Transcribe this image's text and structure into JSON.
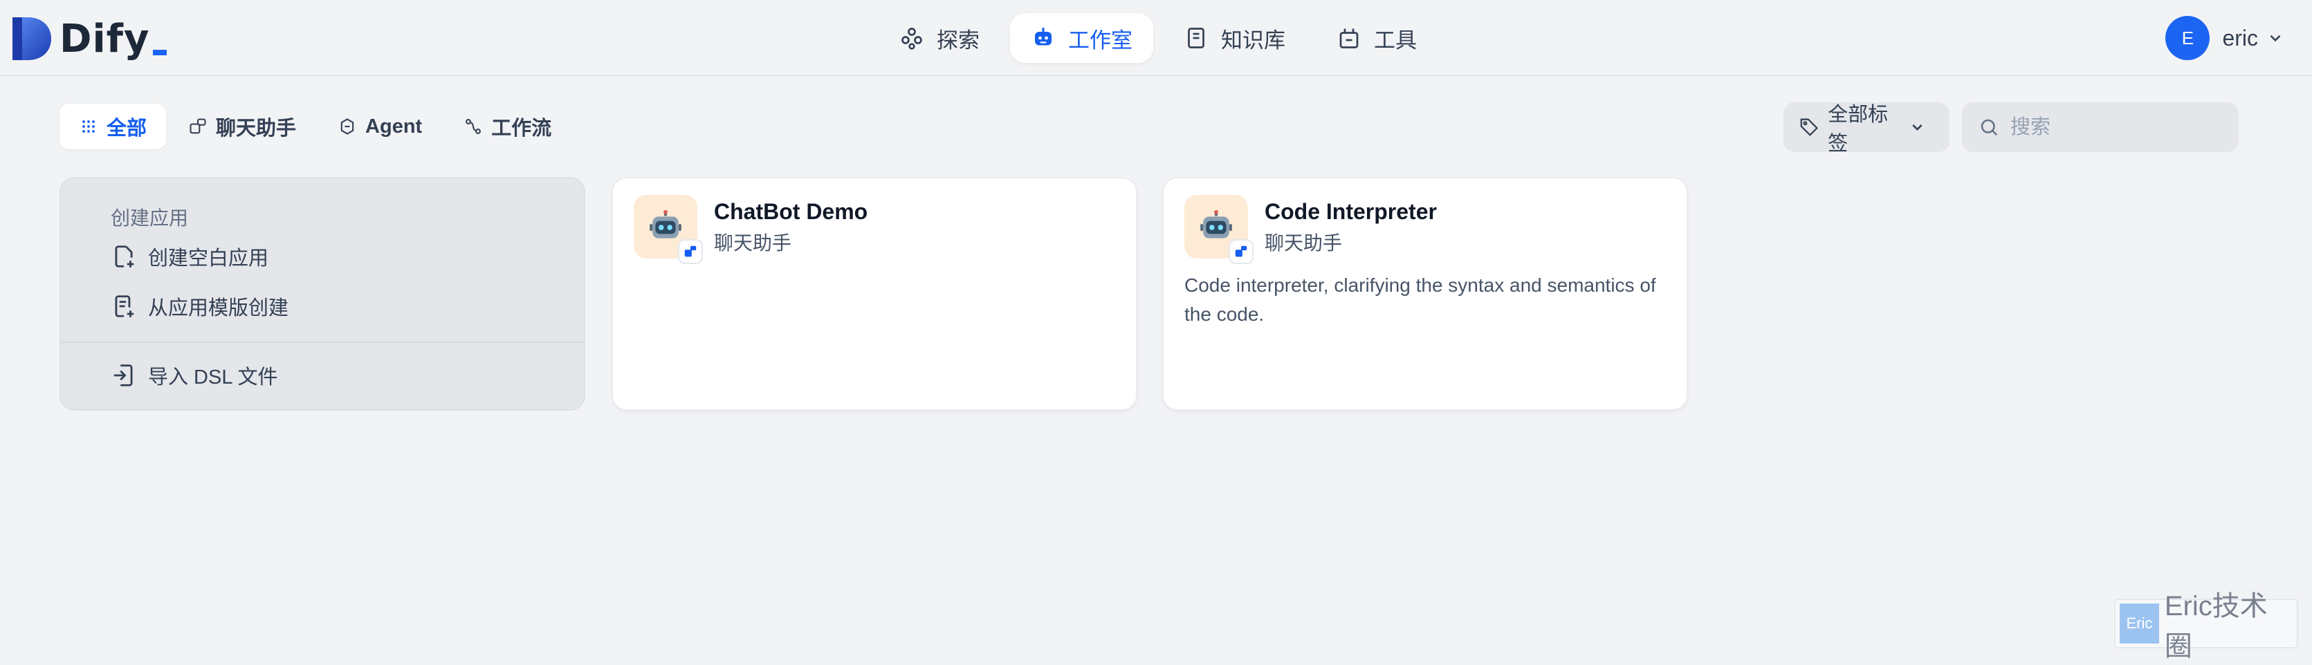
{
  "brand": {
    "name": "Dify"
  },
  "nav": {
    "items": [
      {
        "label": "探索",
        "icon": "explore-icon",
        "active": false
      },
      {
        "label": "工作室",
        "icon": "robot-icon",
        "active": true
      },
      {
        "label": "知识库",
        "icon": "book-icon",
        "active": false
      },
      {
        "label": "工具",
        "icon": "tools-icon",
        "active": false
      }
    ]
  },
  "user": {
    "initial": "E",
    "name": "eric"
  },
  "filters": {
    "tabs": [
      {
        "label": "全部",
        "active": true
      },
      {
        "label": "聊天助手",
        "active": false
      },
      {
        "label": "Agent",
        "active": false
      },
      {
        "label": "工作流",
        "active": false
      }
    ],
    "tag_label": "全部标签",
    "search_placeholder": "搜索"
  },
  "create": {
    "title": "创建应用",
    "blank_label": "创建空白应用",
    "template_label": "从应用模版创建",
    "import_label": "导入 DSL 文件"
  },
  "apps": [
    {
      "name": "ChatBot Demo",
      "type": "聊天助手",
      "description": ""
    },
    {
      "name": "Code Interpreter",
      "type": "聊天助手",
      "description": "Code interpreter, clarifying the syntax and semantics of the code."
    }
  ],
  "watermark": {
    "badge": "Eric",
    "text": "Eric技术圈"
  },
  "colors": {
    "accent": "#155eef",
    "avatar": "#1c64f2",
    "app_icon_bg": "#fdebd6"
  }
}
